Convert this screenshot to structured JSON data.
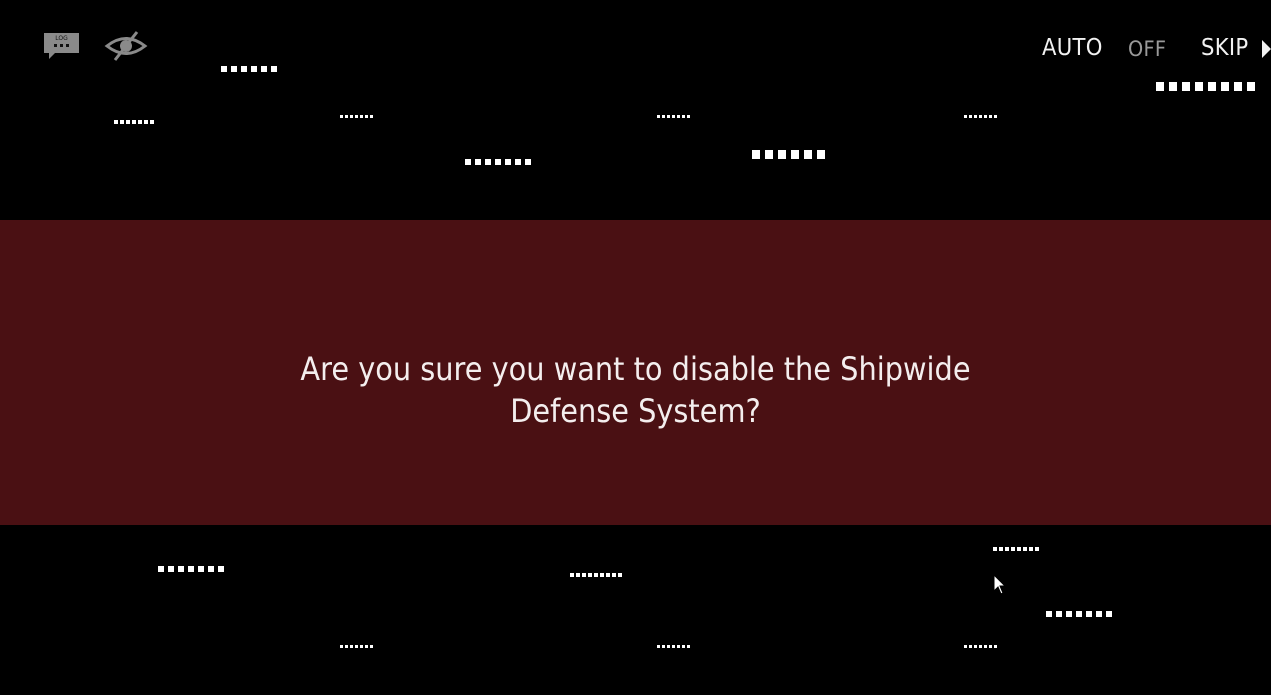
{
  "hud": {
    "left_icons": [
      "log-icon",
      "hide-ui-icon"
    ],
    "log_icon_label": "LOG",
    "auto_label": "AUTO",
    "auto_state": "OFF",
    "skip_label": "SKIP",
    "skip_icon": "play-arrow-icon"
  },
  "dialog": {
    "message_line1": "Are you sure you want to disable the Shipwide",
    "message_line2": "Defense System?"
  },
  "colors": {
    "background": "#000000",
    "dialog_band": "#4a1013",
    "text": "#ffffff",
    "inactive_text": "#9a9a9a"
  },
  "cursor": "mouse-pointer-icon"
}
